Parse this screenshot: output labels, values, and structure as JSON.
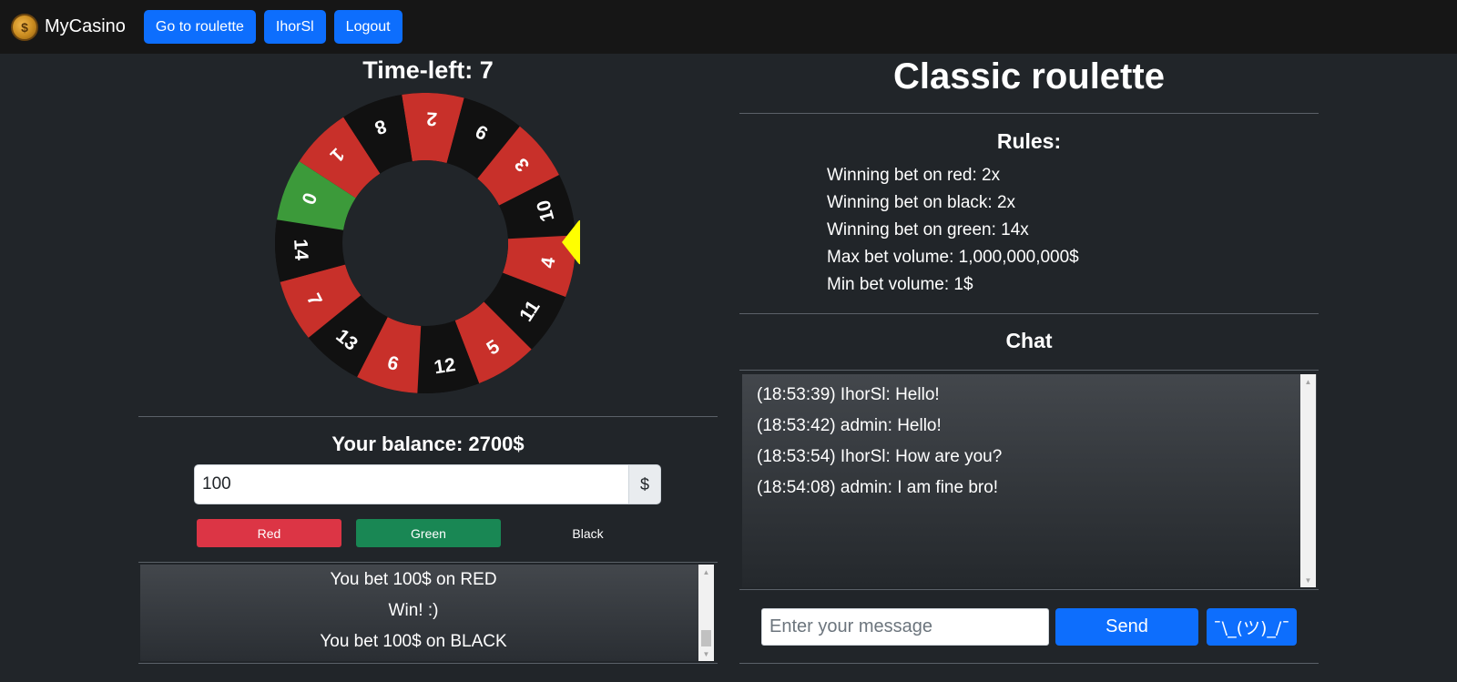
{
  "navbar": {
    "brand": "MyCasino",
    "buttons": [
      "Go to roulette",
      "IhorSl",
      "Logout"
    ]
  },
  "game": {
    "timer_label": "Time-left: 7",
    "wheel": {
      "pointer_color": "#ffff00",
      "pointer_position": "right",
      "segments": [
        {
          "label": "2",
          "color": "#c8302a"
        },
        {
          "label": "9",
          "color": "#111111"
        },
        {
          "label": "3",
          "color": "#c8302a"
        },
        {
          "label": "10",
          "color": "#111111"
        },
        {
          "label": "4",
          "color": "#c8302a"
        },
        {
          "label": "11",
          "color": "#111111"
        },
        {
          "label": "5",
          "color": "#c8302a"
        },
        {
          "label": "12",
          "color": "#111111"
        },
        {
          "label": "6",
          "color": "#c8302a"
        },
        {
          "label": "13",
          "color": "#111111"
        },
        {
          "label": "7",
          "color": "#c8302a"
        },
        {
          "label": "14",
          "color": "#111111"
        },
        {
          "label": "0",
          "color": "#3c9a3a"
        },
        {
          "label": "1",
          "color": "#c8302a"
        },
        {
          "label": "8",
          "color": "#111111"
        }
      ]
    },
    "balance_label": "Your balance: 2700$",
    "bet": {
      "value": "100",
      "currency": "$"
    },
    "buttons": {
      "red": "Red",
      "green": "Green",
      "black": "Black"
    },
    "history": [
      "You bet 100$ on RED",
      "Win! :)",
      "You bet 100$ on BLACK"
    ]
  },
  "info": {
    "title": "Classic roulette",
    "rules_title": "Rules:",
    "rules": [
      "Winning bet on red: 2x",
      "Winning bet on black: 2x",
      "Winning bet on green: 14x",
      "Max bet volume: 1,000,000,000$",
      "Min bet volume: 1$"
    ],
    "chat_title": "Chat",
    "messages": [
      "(18:53:39) IhorSl: Hello!",
      "(18:53:42) admin: Hello!",
      "(18:53:54) IhorSl: How are you?",
      "(18:54:08) admin: I am fine bro!"
    ],
    "chat_placeholder": "Enter your message",
    "send_label": "Send",
    "shrug_label": "¯\\_(ツ)_/¯"
  },
  "colors": {
    "primary": "#0d6efd",
    "danger": "#dc3545",
    "success": "#198754",
    "background": "#212529",
    "navbar": "#161616"
  }
}
